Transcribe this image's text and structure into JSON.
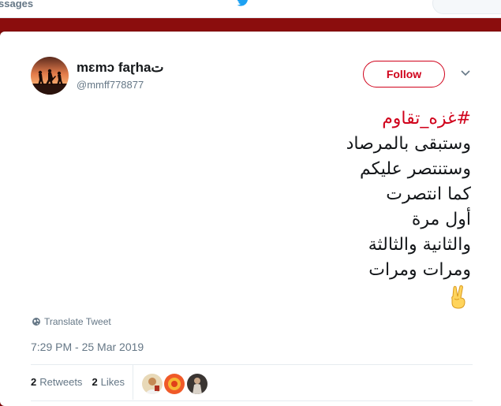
{
  "nav": {
    "messages_label": "ssages"
  },
  "tweet": {
    "display_name": "mɛmɔ faɽhaت",
    "handle": "@mmff778877",
    "follow_label": "Follow",
    "text_lines": [
      "#غزه_تقاوم",
      "وستبقى بالمرصاد",
      "وستنتصر عليكم",
      "كما انتصرت",
      "أول مرة",
      "والثانية والثالثة",
      "ومرات ومرات"
    ],
    "emoji": "✌",
    "translate_label": "Translate Tweet",
    "timestamp": "7:29 PM - 25 Mar 2019",
    "stats": {
      "retweets_count": "2",
      "retweets_label": "Retweets",
      "likes_count": "2",
      "likes_label": "Likes"
    }
  },
  "colors": {
    "accent": "#d0021b",
    "page_background": "#7a0a0a",
    "twitter_blue": "#1da1f2"
  }
}
